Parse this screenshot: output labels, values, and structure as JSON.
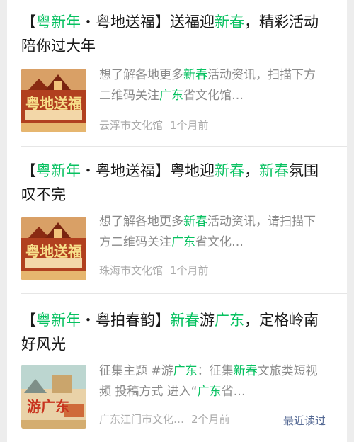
{
  "articles": [
    {
      "title_parts": [
        "【",
        "粤新年",
        "・粤地送福】送福迎",
        "新春",
        "，精彩活动陪你过大年"
      ],
      "desc_parts": [
        "想了解各地更多",
        "新春",
        "活动资讯，扫描下方二维码关注",
        "广东",
        "省文化馆…"
      ],
      "source": "云浮市文化馆",
      "time": "1个月前",
      "thumb_text": "粤地送福",
      "thumb_icon": "poster-thumbnail"
    },
    {
      "title_parts": [
        "【",
        "粤新年",
        "・粤地送福】粤地迎",
        "新春",
        "，",
        "新春",
        "氛围叹不完"
      ],
      "desc_parts": [
        "想了解各地更多",
        "新春",
        "活动资讯，请扫描下方二维码关注",
        "广东",
        "省文化…"
      ],
      "source": "珠海市文化馆",
      "time": "1个月前",
      "thumb_text": "粤地送福",
      "thumb_icon": "poster-thumbnail"
    },
    {
      "title_parts": [
        "【",
        "粤新年",
        "・粤拍春韵】",
        "新春",
        "游",
        "广东",
        "，定格岭南好风光"
      ],
      "desc_parts": [
        "征集主题 #游",
        "广东",
        "：征集",
        "新春",
        "文旅类短视频 投稿方式 进入“",
        "广东",
        "省…"
      ],
      "source": "广东江门市文化…",
      "time": "2个月前",
      "badge": "最近读过",
      "thumb_text": "游广东",
      "thumb_icon": "poster-thumbnail"
    }
  ],
  "colors": {
    "highlight": "#07c160",
    "meta": "#aaaaaa",
    "link": "#576b95"
  }
}
